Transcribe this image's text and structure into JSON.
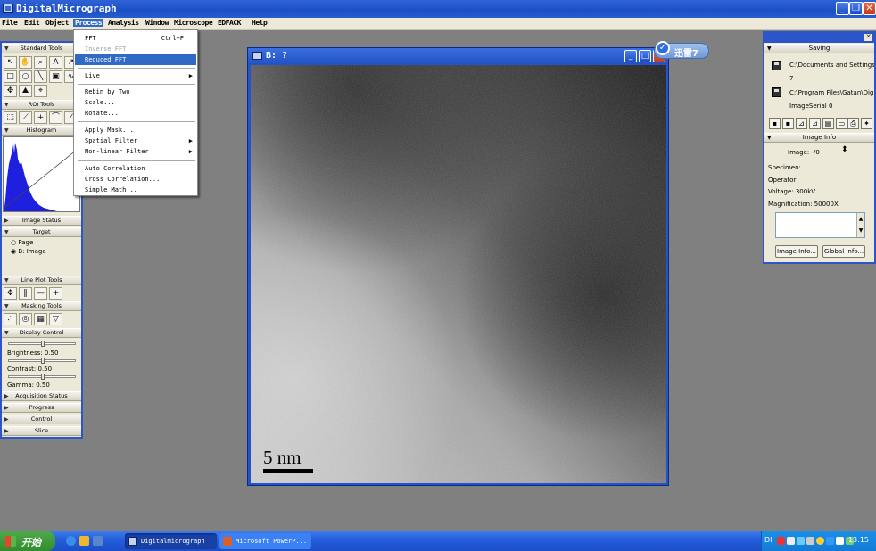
{
  "app": {
    "title": "DigitalMicrograph"
  },
  "menubar": [
    "File",
    "Edit",
    "Object",
    "Process",
    "Analysis",
    "Window",
    "Microscope",
    "EDFACK",
    "Help"
  ],
  "process_menu": [
    {
      "label": "FFT",
      "shortcut": "Ctrl+F"
    },
    {
      "label": "Inverse FFT",
      "disabled": true
    },
    {
      "label": "Reduced FFT",
      "highlighted": true
    },
    {
      "label": "Live",
      "submenu": true
    },
    {
      "label": "Rebin by Two"
    },
    {
      "label": "Scale..."
    },
    {
      "label": "Rotate..."
    },
    {
      "label": "Apply Mask..."
    },
    {
      "label": "Spatial Filter",
      "submenu": true
    },
    {
      "label": "Non-linear Filter",
      "submenu": true
    },
    {
      "label": "Auto Correlation"
    },
    {
      "label": "Cross Correlation..."
    },
    {
      "label": "Simple Math..."
    }
  ],
  "left_panel": {
    "sections": [
      "Standard Tools",
      "ROI Tools",
      "Histogram",
      "Image Status",
      "Target",
      "Line Plot Tools",
      "Masking Tools",
      "Display Control",
      "Acquisition Status",
      "Progress",
      "Control",
      "Slice"
    ],
    "target_items": [
      "Page",
      "B: Image"
    ],
    "display_control": {
      "brightness": "Brightness: 0.50",
      "contrast": "Contrast: 0.50",
      "gamma": "Gamma: 0.50"
    }
  },
  "image_window": {
    "title": "B: ?",
    "scale_bar": "5 nm"
  },
  "badge": {
    "label": "迅雷7"
  },
  "right_panel": {
    "saving_title": "Saving",
    "path1": "C:\\Documents and Settings\\",
    "path1_suffix": "7",
    "path2": "C:\\Program Files\\Gatan\\Digi",
    "image_serial": "ImageSerial 0",
    "info_title": "Image Info",
    "image_label": "Image: -/0",
    "specimen": "Specimen:",
    "operator": "Operator:",
    "voltage": "Voltage: 300kV",
    "magnification": "Magnification: 50000X",
    "btn_image_info": "Image Info...",
    "btn_global_info": "Global Info..."
  },
  "taskbar": {
    "start": "开始",
    "tasks": [
      "DigitalMicrograph",
      "Microsoft PowerP..."
    ],
    "tray_lang": "DI",
    "clock": "13:15"
  },
  "colors": {
    "titlebar": "#1b4fc6",
    "menu_highlight": "#316ac5",
    "workspace": "#808080",
    "taskbar": "#245edb",
    "histogram": "#1f1fe0"
  }
}
